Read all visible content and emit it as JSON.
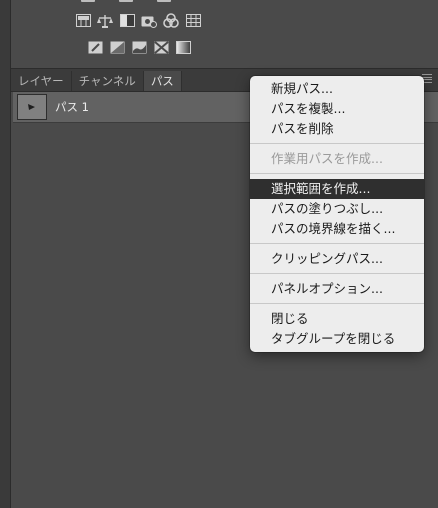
{
  "colors": {
    "panel_bg": "#4a4a4a",
    "tabbar_bg": "#3b3b3b",
    "selected_row_bg": "#626262",
    "menu_bg": "#ededed",
    "menu_highlight": "#2f2f2f"
  },
  "adjustments": {
    "row1_icons": [
      "levels-icon",
      "color-balance-icon",
      "black-white-icon",
      "photo-filter-icon",
      "channel-mixer-icon",
      "color-lookup-icon"
    ],
    "row2_icons": [
      "invert-icon",
      "posterize-icon",
      "threshold-icon",
      "selective-color-icon",
      "gradient-map-icon"
    ]
  },
  "tabs": [
    {
      "label": "レイヤー"
    },
    {
      "label": "チャンネル"
    },
    {
      "label": "パス"
    }
  ],
  "paths": {
    "items": [
      {
        "name": "パス 1"
      }
    ]
  },
  "context_menu": {
    "items": [
      {
        "label": "新規パス..."
      },
      {
        "label": "パスを複製..."
      },
      {
        "label": "パスを削除"
      },
      {
        "label": "作業用パスを作成..."
      },
      {
        "label": "選択範囲を作成..."
      },
      {
        "label": "パスの塗りつぶし..."
      },
      {
        "label": "パスの境界線を描く..."
      },
      {
        "label": "クリッピングパス..."
      },
      {
        "label": "パネルオプション..."
      },
      {
        "label": "閉じる"
      },
      {
        "label": "タブグループを閉じる"
      }
    ]
  }
}
